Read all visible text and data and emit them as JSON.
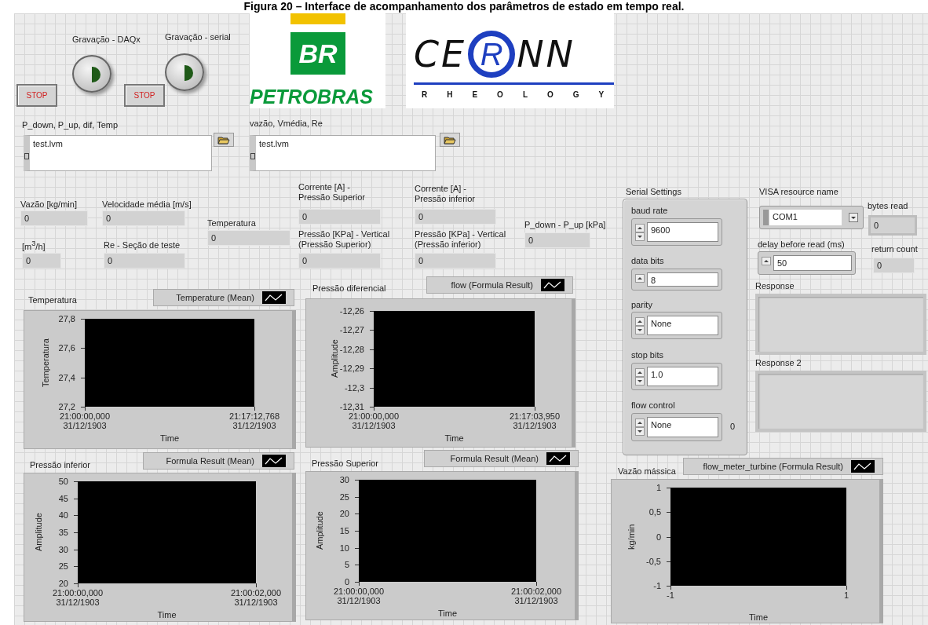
{
  "caption": "Figura 20 – Interface de acompanhamento dos parâmetros de estado em tempo real.",
  "stop_buttons": [
    {
      "label": "STOP"
    },
    {
      "label": "STOP"
    }
  ],
  "recording_buttons": [
    {
      "label": "Gravação - DAQx",
      "on": false
    },
    {
      "label": "Gravação - serial",
      "on": false
    }
  ],
  "logos": {
    "petrobras": {
      "mark": "BR",
      "name": "PETROBRAS"
    },
    "cernn": {
      "left": "CE",
      "circled": "R",
      "right": "NN",
      "tagline": "RHEOLOGY"
    }
  },
  "file_paths": [
    {
      "label": "P_down, P_up, dif, Temp",
      "value": "test.lvm"
    },
    {
      "label": "vazão, Vmédia, Re",
      "value": "test.lvm"
    }
  ],
  "indicators": [
    {
      "label": "Vazão [kg/min]",
      "value": "0"
    },
    {
      "label": "Velocidade média [m/s]",
      "value": "0"
    },
    {
      "label": "[m$^{3}$/h]",
      "value": "0"
    },
    {
      "label": "Re - Seção de teste",
      "value": "0"
    },
    {
      "label": "Temperatura",
      "value": "0"
    },
    {
      "label": "Corrente [A] -\nPressão Superior",
      "value": "0"
    },
    {
      "label": "Pressão [KPa] - Vertical\n(Pressão Superior)",
      "value": "0"
    },
    {
      "label": "Corrente [A] -\nPressão inferior",
      "value": "0"
    },
    {
      "label": "Pressão [KPa] - Vertical\n(Pressão inferior)",
      "value": "0"
    },
    {
      "label": "P_down - P_up [kPa]",
      "value": "0"
    }
  ],
  "serial_settings": {
    "title": "Serial Settings",
    "fields": [
      {
        "label": "baud rate",
        "value": "9600",
        "kind": "updown"
      },
      {
        "label": "data bits",
        "value": "8",
        "kind": "up"
      },
      {
        "label": "parity",
        "value": "None",
        "kind": "updown"
      },
      {
        "label": "stop bits",
        "value": "1.0",
        "kind": "updown"
      },
      {
        "label": "flow control",
        "value": "None",
        "kind": "updown"
      }
    ],
    "flow_control_code": "0"
  },
  "visa": {
    "label": "VISA resource name",
    "value": "COM1"
  },
  "bytes_read": {
    "label": "bytes read",
    "value": "0"
  },
  "delay": {
    "label": "delay before read (ms)",
    "value": "50"
  },
  "return_count": {
    "label": "return count",
    "value": "0"
  },
  "responses": [
    {
      "label": "Response"
    },
    {
      "label": "Response 2"
    }
  ],
  "charts": [
    {
      "title": "Temperatura",
      "legend": "Temperature (Mean)",
      "ylabel": "Temperatura",
      "yticks": [
        "27,8",
        "27,6",
        "27,4",
        "27,2"
      ],
      "xticks": [
        {
          "time": "21:00:00,000",
          "date": "31/12/1903"
        },
        {
          "time": "21:17:12,768",
          "date": "31/12/1903"
        }
      ],
      "xlabel": "Time"
    },
    {
      "title": "Pressão diferencial",
      "legend": "flow (Formula Result)",
      "ylabel": "Amplitude",
      "yticks": [
        "-12,26",
        "-12,27",
        "-12,28",
        "-12,29",
        "-12,3",
        "-12,31"
      ],
      "xticks": [
        {
          "time": "21:00:00,000",
          "date": "31/12/1903"
        },
        {
          "time": "21:17:03,950",
          "date": "31/12/1903"
        }
      ],
      "xlabel": "Time"
    },
    {
      "title": "Pressão inferior",
      "legend": "Formula Result (Mean)",
      "ylabel": "Amplitude",
      "yticks": [
        "50",
        "45",
        "40",
        "35",
        "30",
        "25",
        "20"
      ],
      "xticks": [
        {
          "time": "21:00:00,000",
          "date": "31/12/1903"
        },
        {
          "time": "21:00:02,000",
          "date": "31/12/1903"
        }
      ],
      "xlabel": "Time"
    },
    {
      "title": "Pressão Superior",
      "legend": "Formula Result (Mean)",
      "ylabel": "Amplitude",
      "yticks": [
        "30",
        "25",
        "20",
        "15",
        "10",
        "5",
        "0"
      ],
      "xticks": [
        {
          "time": "21:00:00,000",
          "date": "31/12/1903"
        },
        {
          "time": "21:00:02,000",
          "date": "31/12/1903"
        }
      ],
      "xlabel": "Time"
    },
    {
      "title": "Vazão mássica",
      "legend": "flow_meter_turbine (Formula Result)",
      "ylabel": "kg/min",
      "yticks": [
        "1",
        "0,5",
        "0",
        "-0,5",
        "-1"
      ],
      "xticks": [
        {
          "time": "-1"
        },
        {
          "time": "1"
        }
      ],
      "xlabel": "Time"
    }
  ]
}
